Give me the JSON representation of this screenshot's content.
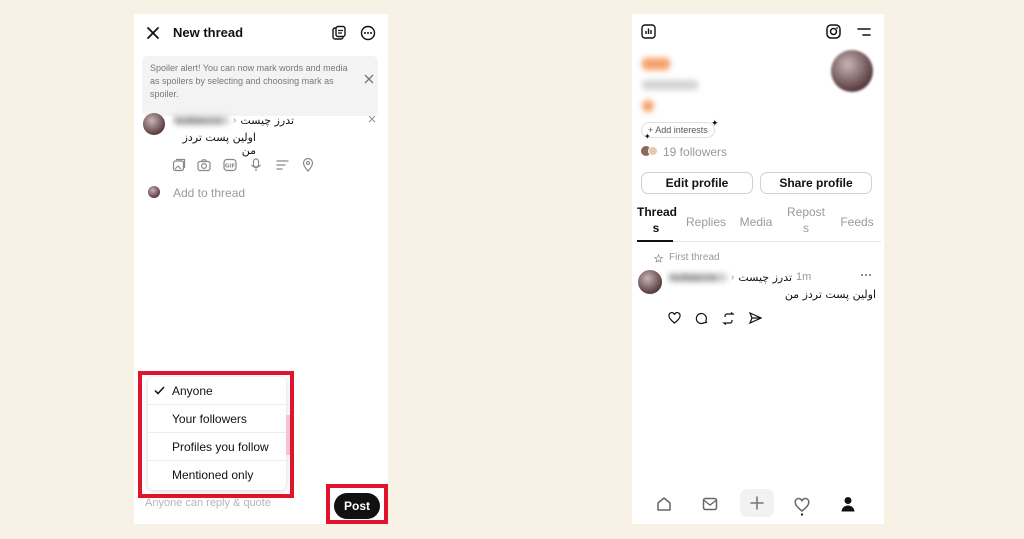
{
  "compose": {
    "title": "New thread",
    "spoiler_text": "Spoiler alert! You can now mark words and media as spoilers by selecting and choosing mark as spoiler.",
    "username": "hedfaterne",
    "topic_sep": "›",
    "topic": "تدرز چیست",
    "post_text": "اولین پست تردز من",
    "add_to_thread": "Add to thread",
    "reply_options": [
      "Anyone",
      "Your followers",
      "Profiles you follow",
      "Mentioned only"
    ],
    "selected_option": "Anyone",
    "footer_hint": "Anyone can reply & quote",
    "post_label": "Post"
  },
  "profile": {
    "add_interests": "+ Add interests",
    "followers": "19 followers",
    "edit_profile": "Edit profile",
    "share_profile": "Share profile",
    "tabs": [
      {
        "label": "Thread s",
        "active": true
      },
      {
        "label": "Replies",
        "active": false
      },
      {
        "label": "Media",
        "active": false
      },
      {
        "label": "Repost s",
        "active": false
      },
      {
        "label": "Feeds",
        "active": false
      }
    ],
    "pinned_label": "First thread",
    "post": {
      "username": "hedfaterne",
      "topic_sep": "›",
      "topic": "تدرز چیست",
      "time": "1m",
      "text": "اولین پست تردز من"
    }
  },
  "colors": {
    "highlight": "#e0142c",
    "background": "#f8f2e6"
  }
}
